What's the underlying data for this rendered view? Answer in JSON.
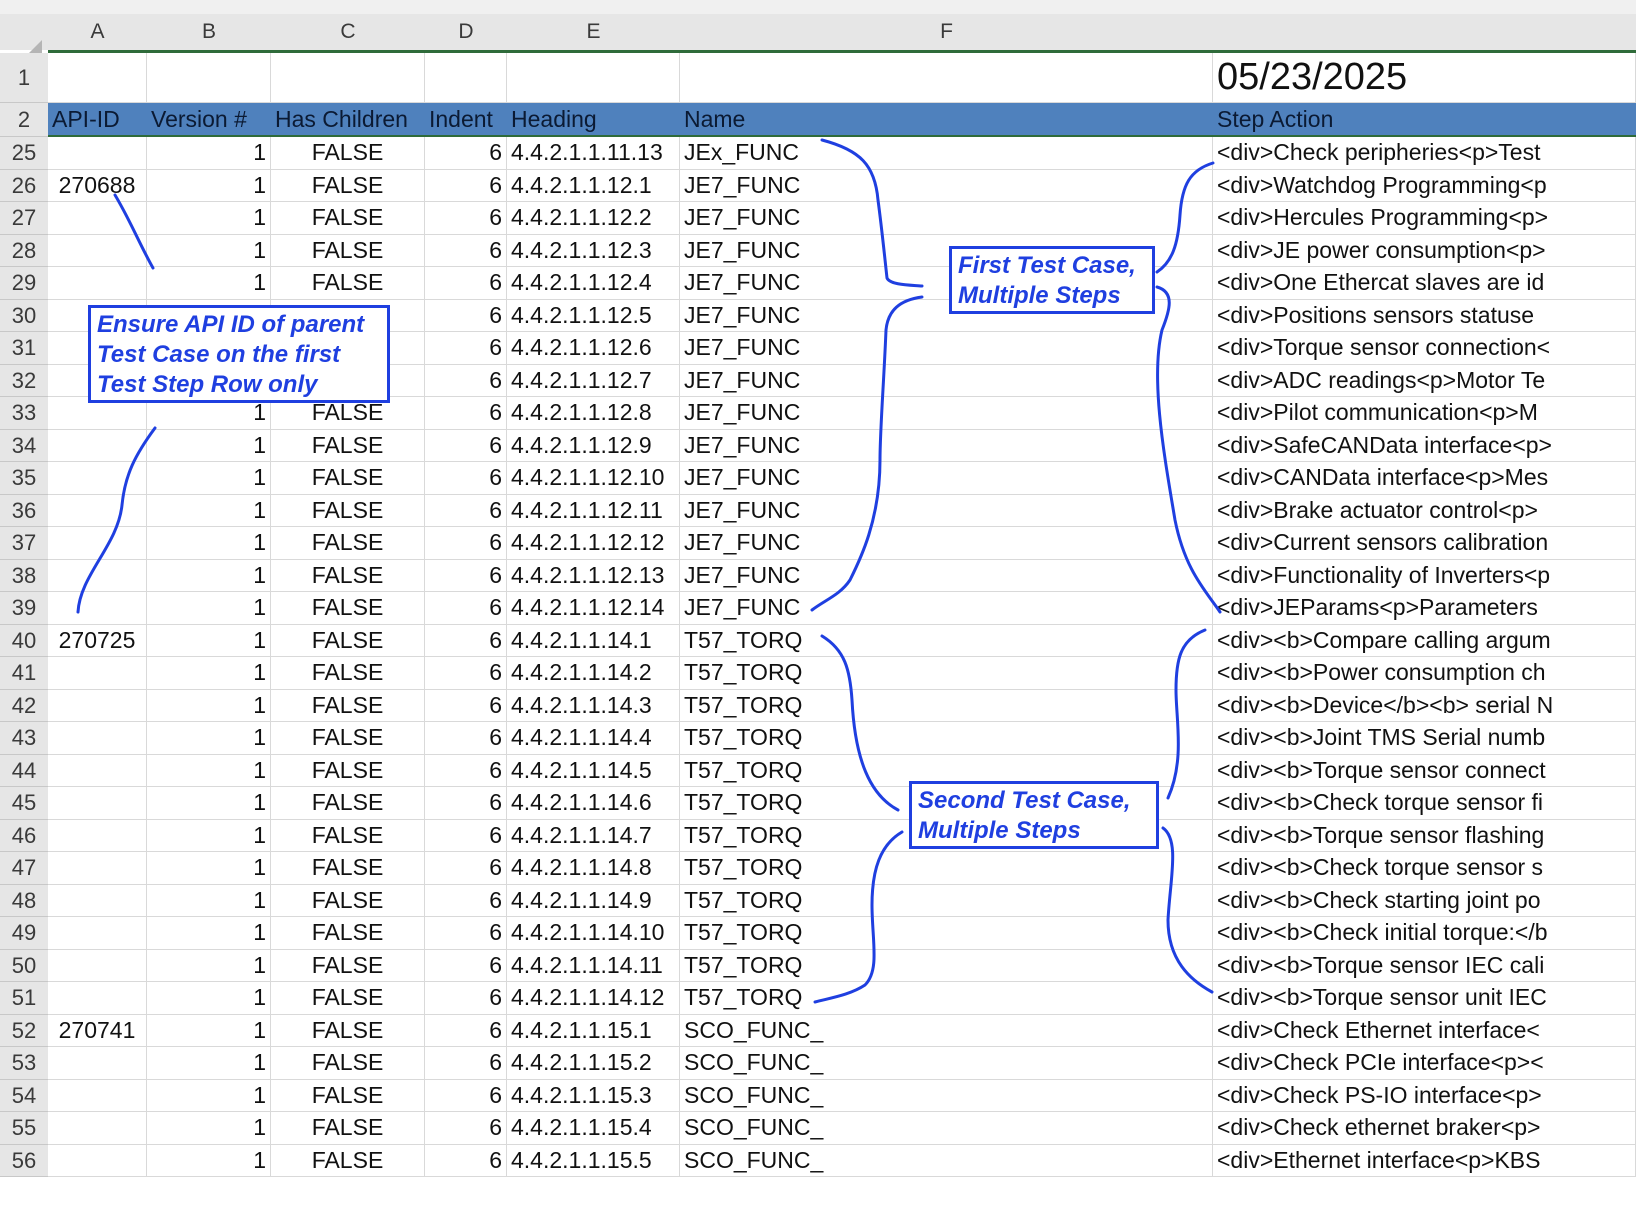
{
  "columns": [
    "A",
    "B",
    "C",
    "D",
    "E",
    "F"
  ],
  "row1": {
    "number": "1",
    "date": "05/23/2025"
  },
  "header_row": {
    "number": "2",
    "cells": [
      "API-ID",
      "Version #",
      "Has Children",
      "Indent",
      "Heading",
      "Name",
      "Step Action"
    ]
  },
  "rows": [
    {
      "n": "25",
      "id": "",
      "v": "1",
      "hc": "FALSE",
      "ind": "6",
      "h": "4.4.2.1.1.11.13",
      "name": "JEx_FUNC",
      "step": "<div>Check peripheries<p>Test"
    },
    {
      "n": "26",
      "id": "270688",
      "v": "1",
      "hc": "FALSE",
      "ind": "6",
      "h": "4.4.2.1.1.12.1",
      "name": "JE7_FUNC",
      "step": "<div>Watchdog Programming<p"
    },
    {
      "n": "27",
      "id": "",
      "v": "1",
      "hc": "FALSE",
      "ind": "6",
      "h": "4.4.2.1.1.12.2",
      "name": "JE7_FUNC",
      "step": "<div>Hercules Programming<p>"
    },
    {
      "n": "28",
      "id": "",
      "v": "1",
      "hc": "FALSE",
      "ind": "6",
      "h": "4.4.2.1.1.12.3",
      "name": "JE7_FUNC",
      "step": "<div>JE power consumption<p>"
    },
    {
      "n": "29",
      "id": "",
      "v": "1",
      "hc": "FALSE",
      "ind": "6",
      "h": "4.4.2.1.1.12.4",
      "name": "JE7_FUNC",
      "step": "<div>One Ethercat slaves are id"
    },
    {
      "n": "30",
      "id": "",
      "v": "",
      "hc": "",
      "ind": "6",
      "h": "4.4.2.1.1.12.5",
      "name": "JE7_FUNC",
      "step": "<div>Positions sensors statuse"
    },
    {
      "n": "31",
      "id": "",
      "v": "",
      "hc": "",
      "ind": "6",
      "h": "4.4.2.1.1.12.6",
      "name": "JE7_FUNC",
      "step": "<div>Torque sensor connection<"
    },
    {
      "n": "32",
      "id": "",
      "v": "",
      "hc": "",
      "ind": "6",
      "h": "4.4.2.1.1.12.7",
      "name": "JE7_FUNC",
      "step": "<div>ADC readings<p>Motor Te"
    },
    {
      "n": "33",
      "id": "",
      "v": "1",
      "hc": "FALSE",
      "ind": "6",
      "h": "4.4.2.1.1.12.8",
      "name": "JE7_FUNC",
      "step": "<div>Pilot communication<p>M"
    },
    {
      "n": "34",
      "id": "",
      "v": "1",
      "hc": "FALSE",
      "ind": "6",
      "h": "4.4.2.1.1.12.9",
      "name": "JE7_FUNC",
      "step": "<div>SafeCANData interface<p>"
    },
    {
      "n": "35",
      "id": "",
      "v": "1",
      "hc": "FALSE",
      "ind": "6",
      "h": "4.4.2.1.1.12.10",
      "name": "JE7_FUNC",
      "step": "<div>CANData interface<p>Mes"
    },
    {
      "n": "36",
      "id": "",
      "v": "1",
      "hc": "FALSE",
      "ind": "6",
      "h": "4.4.2.1.1.12.11",
      "name": "JE7_FUNC",
      "step": "<div>Brake actuator control<p>"
    },
    {
      "n": "37",
      "id": "",
      "v": "1",
      "hc": "FALSE",
      "ind": "6",
      "h": "4.4.2.1.1.12.12",
      "name": "JE7_FUNC",
      "step": "<div>Current sensors calibration"
    },
    {
      "n": "38",
      "id": "",
      "v": "1",
      "hc": "FALSE",
      "ind": "6",
      "h": "4.4.2.1.1.12.13",
      "name": "JE7_FUNC",
      "step": "<div>Functionality of Inverters<p"
    },
    {
      "n": "39",
      "id": "",
      "v": "1",
      "hc": "FALSE",
      "ind": "6",
      "h": "4.4.2.1.1.12.14",
      "name": "JE7_FUNC",
      "step": "<div>JEParams<p>Parameters"
    },
    {
      "n": "40",
      "id": "270725",
      "v": "1",
      "hc": "FALSE",
      "ind": "6",
      "h": "4.4.2.1.1.14.1",
      "name": "T57_TORQ",
      "step": "<div><b>Compare calling argum"
    },
    {
      "n": "41",
      "id": "",
      "v": "1",
      "hc": "FALSE",
      "ind": "6",
      "h": "4.4.2.1.1.14.2",
      "name": "T57_TORQ",
      "step": "<div><b>Power consumption ch"
    },
    {
      "n": "42",
      "id": "",
      "v": "1",
      "hc": "FALSE",
      "ind": "6",
      "h": "4.4.2.1.1.14.3",
      "name": "T57_TORQ",
      "step": "<div><b>Device</b><b> serial N"
    },
    {
      "n": "43",
      "id": "",
      "v": "1",
      "hc": "FALSE",
      "ind": "6",
      "h": "4.4.2.1.1.14.4",
      "name": "T57_TORQ",
      "step": "<div><b>Joint TMS Serial numb"
    },
    {
      "n": "44",
      "id": "",
      "v": "1",
      "hc": "FALSE",
      "ind": "6",
      "h": "4.4.2.1.1.14.5",
      "name": "T57_TORQ",
      "step": "<div><b>Torque sensor connect"
    },
    {
      "n": "45",
      "id": "",
      "v": "1",
      "hc": "FALSE",
      "ind": "6",
      "h": "4.4.2.1.1.14.6",
      "name": "T57_TORQ",
      "step": "<div><b>Check torque sensor fi"
    },
    {
      "n": "46",
      "id": "",
      "v": "1",
      "hc": "FALSE",
      "ind": "6",
      "h": "4.4.2.1.1.14.7",
      "name": "T57_TORQ",
      "step": "<div><b>Torque sensor flashing"
    },
    {
      "n": "47",
      "id": "",
      "v": "1",
      "hc": "FALSE",
      "ind": "6",
      "h": "4.4.2.1.1.14.8",
      "name": "T57_TORQ",
      "step": "<div><b>Check torque sensor s"
    },
    {
      "n": "48",
      "id": "",
      "v": "1",
      "hc": "FALSE",
      "ind": "6",
      "h": "4.4.2.1.1.14.9",
      "name": "T57_TORQ",
      "step": "<div><b>Check starting joint po"
    },
    {
      "n": "49",
      "id": "",
      "v": "1",
      "hc": "FALSE",
      "ind": "6",
      "h": "4.4.2.1.1.14.10",
      "name": "T57_TORQ",
      "step": "<div><b>Check initial torque:</b"
    },
    {
      "n": "50",
      "id": "",
      "v": "1",
      "hc": "FALSE",
      "ind": "6",
      "h": "4.4.2.1.1.14.11",
      "name": "T57_TORQ",
      "step": "<div><b>Torque sensor IEC cali"
    },
    {
      "n": "51",
      "id": "",
      "v": "1",
      "hc": "FALSE",
      "ind": "6",
      "h": "4.4.2.1.1.14.12",
      "name": "T57_TORQ",
      "step": "<div><b>Torque sensor unit IEC"
    },
    {
      "n": "52",
      "id": "270741",
      "v": "1",
      "hc": "FALSE",
      "ind": "6",
      "h": "4.4.2.1.1.15.1",
      "name": "SCO_FUNC_",
      "step": "<div>Check Ethernet interface<"
    },
    {
      "n": "53",
      "id": "",
      "v": "1",
      "hc": "FALSE",
      "ind": "6",
      "h": "4.4.2.1.1.15.2",
      "name": "SCO_FUNC_",
      "step": "<div>Check PCIe interface<p><"
    },
    {
      "n": "54",
      "id": "",
      "v": "1",
      "hc": "FALSE",
      "ind": "6",
      "h": "4.4.2.1.1.15.3",
      "name": "SCO_FUNC_",
      "step": "<div>Check PS-IO interface<p>"
    },
    {
      "n": "55",
      "id": "",
      "v": "1",
      "hc": "FALSE",
      "ind": "6",
      "h": "4.4.2.1.1.15.4",
      "name": "SCO_FUNC_",
      "step": "<div>Check ethernet braker<p>"
    },
    {
      "n": "56",
      "id": "",
      "v": "1",
      "hc": "FALSE",
      "ind": "6",
      "h": "4.4.2.1.1.15.5",
      "name": "SCO_FUNC_",
      "step": "<div>Ethernet interface<p>KBS"
    }
  ],
  "annotations": {
    "api_note": [
      "Ensure API ID of parent",
      "Test Case on the first",
      "Test Step Row only"
    ],
    "first_case": [
      "First Test Case,",
      "Multiple Steps"
    ],
    "second_case": [
      "Second Test Case,",
      "Multiple Steps"
    ],
    "color": "#1f3fe0"
  },
  "colors": {
    "header_fill": "#4f81bd",
    "header_underline": "#2f6b3a"
  }
}
